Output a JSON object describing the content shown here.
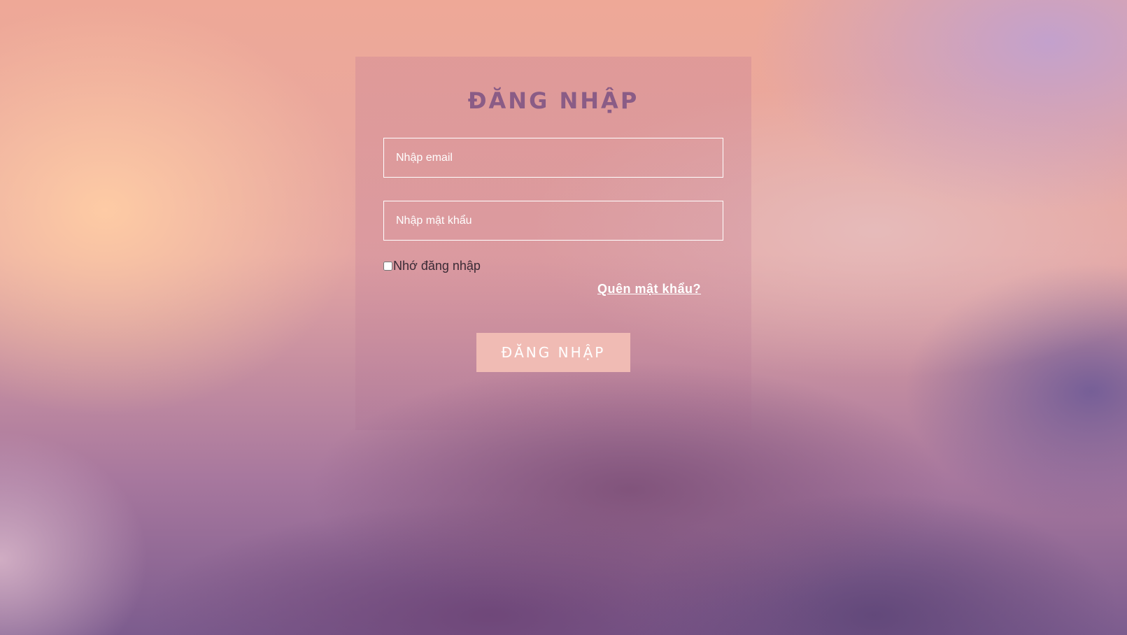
{
  "login": {
    "title": "ĐĂNG NHẬP",
    "email_placeholder": "Nhập email",
    "password_placeholder": "Nhập mật khẩu",
    "remember_label": "Nhớ đăng nhập",
    "remember_checked": false,
    "forgot_label": "Quên mật khẩu?",
    "submit_label": "ĐĂNG NHẬP"
  },
  "colors": {
    "title": "#8a5c86",
    "button_bg": "#f0bbb4",
    "field_border": "#ffffff"
  }
}
